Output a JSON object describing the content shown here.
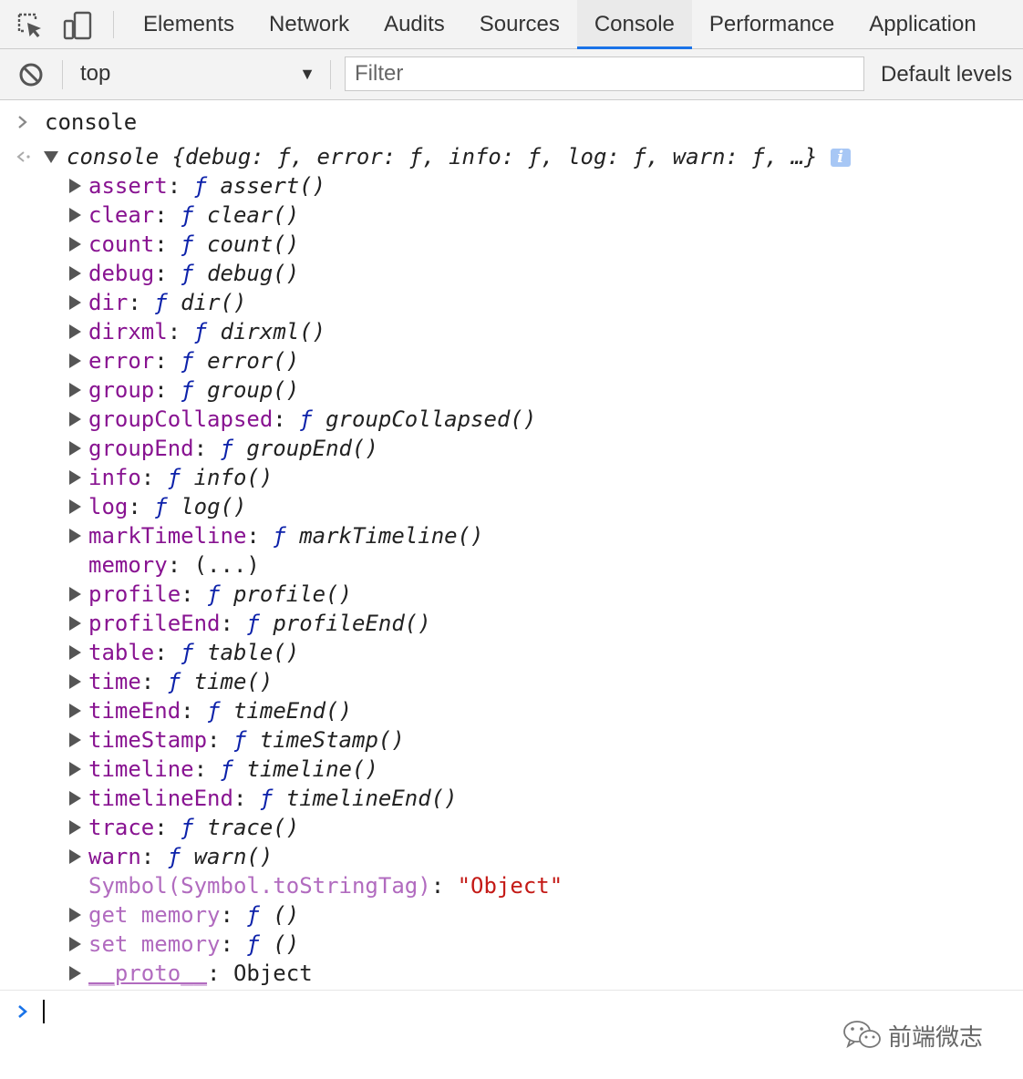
{
  "colors": {
    "tab_underline": "#1a73e8",
    "property_name": "#881391",
    "function_marker": "#0d22aa",
    "string_value": "#c41a16",
    "prompt_caret": "#1a73e8"
  },
  "tabs": [
    {
      "label": "Elements"
    },
    {
      "label": "Network"
    },
    {
      "label": "Audits"
    },
    {
      "label": "Sources"
    },
    {
      "label": "Console",
      "selected": true
    },
    {
      "label": "Performance"
    },
    {
      "label": "Application"
    }
  ],
  "toolbar": {
    "clear_icon": "block-icon",
    "context": "top",
    "filter_placeholder": "Filter",
    "levels": "Default levels"
  },
  "console": {
    "input_command": "console",
    "result_summary": {
      "name": "console",
      "preview": "{debug: ƒ, error: ƒ, info: ƒ, log: ƒ, warn: ƒ, …}"
    },
    "properties": [
      {
        "name": "assert",
        "fn": "ƒ",
        "sig": "assert()"
      },
      {
        "name": "clear",
        "fn": "ƒ",
        "sig": "clear()"
      },
      {
        "name": "count",
        "fn": "ƒ",
        "sig": "count()"
      },
      {
        "name": "debug",
        "fn": "ƒ",
        "sig": "debug()"
      },
      {
        "name": "dir",
        "fn": "ƒ",
        "sig": "dir()"
      },
      {
        "name": "dirxml",
        "fn": "ƒ",
        "sig": "dirxml()"
      },
      {
        "name": "error",
        "fn": "ƒ",
        "sig": "error()"
      },
      {
        "name": "group",
        "fn": "ƒ",
        "sig": "group()"
      },
      {
        "name": "groupCollapsed",
        "fn": "ƒ",
        "sig": "groupCollapsed()"
      },
      {
        "name": "groupEnd",
        "fn": "ƒ",
        "sig": "groupEnd()"
      },
      {
        "name": "info",
        "fn": "ƒ",
        "sig": "info()"
      },
      {
        "name": "log",
        "fn": "ƒ",
        "sig": "log()"
      },
      {
        "name": "markTimeline",
        "fn": "ƒ",
        "sig": "markTimeline()"
      },
      {
        "name": "memory",
        "value": "(...)",
        "no_toggle": true
      },
      {
        "name": "profile",
        "fn": "ƒ",
        "sig": "profile()"
      },
      {
        "name": "profileEnd",
        "fn": "ƒ",
        "sig": "profileEnd()"
      },
      {
        "name": "table",
        "fn": "ƒ",
        "sig": "table()"
      },
      {
        "name": "time",
        "fn": "ƒ",
        "sig": "time()"
      },
      {
        "name": "timeEnd",
        "fn": "ƒ",
        "sig": "timeEnd()"
      },
      {
        "name": "timeStamp",
        "fn": "ƒ",
        "sig": "timeStamp()"
      },
      {
        "name": "timeline",
        "fn": "ƒ",
        "sig": "timeline()"
      },
      {
        "name": "timelineEnd",
        "fn": "ƒ",
        "sig": "timelineEnd()"
      },
      {
        "name": "trace",
        "fn": "ƒ",
        "sig": "trace()"
      },
      {
        "name": "warn",
        "fn": "ƒ",
        "sig": "warn()"
      },
      {
        "name": "Symbol(Symbol.toStringTag)",
        "string": "\"Object\"",
        "no_toggle": true,
        "dim": true
      },
      {
        "name": "get memory",
        "fn": "ƒ",
        "sig": "()",
        "dim": true
      },
      {
        "name": "set memory",
        "fn": "ƒ",
        "sig": "()",
        "dim": true
      },
      {
        "name": "__proto__",
        "value": "Object",
        "dim": true,
        "underline": true
      }
    ]
  },
  "watermark": {
    "text": "前端微志",
    "icon": "wechat-icon"
  }
}
